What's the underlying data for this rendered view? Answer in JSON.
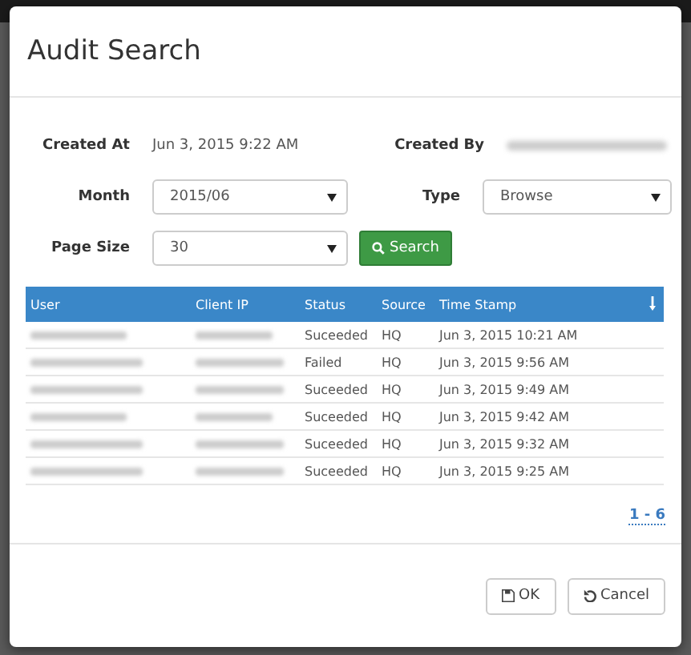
{
  "dialog": {
    "title": "Audit Search"
  },
  "form": {
    "created_at_label": "Created At",
    "created_at_value": "Jun 3, 2015 9:22 AM",
    "created_by_label": "Created By",
    "month_label": "Month",
    "month_value": "2015/06",
    "type_label": "Type",
    "type_value": "Browse",
    "page_size_label": "Page Size",
    "page_size_value": "30",
    "search_button": "Search"
  },
  "table": {
    "columns": [
      "User",
      "Client IP",
      "Status",
      "Source",
      "Time Stamp"
    ],
    "rows": [
      {
        "status": "Suceeded",
        "source": "HQ",
        "time_stamp": "Jun 3, 2015 10:21 AM"
      },
      {
        "status": "Failed",
        "source": "HQ",
        "time_stamp": "Jun 3, 2015 9:56 AM"
      },
      {
        "status": "Suceeded",
        "source": "HQ",
        "time_stamp": "Jun 3, 2015 9:49 AM"
      },
      {
        "status": "Suceeded",
        "source": "HQ",
        "time_stamp": "Jun 3, 2015 9:42 AM"
      },
      {
        "status": "Suceeded",
        "source": "HQ",
        "time_stamp": "Jun 3, 2015 9:32 AM"
      },
      {
        "status": "Suceeded",
        "source": "HQ",
        "time_stamp": "Jun 3, 2015 9:25 AM"
      }
    ]
  },
  "pagination": "1 - 6",
  "buttons": [
    "OK",
    "Cancel"
  ]
}
